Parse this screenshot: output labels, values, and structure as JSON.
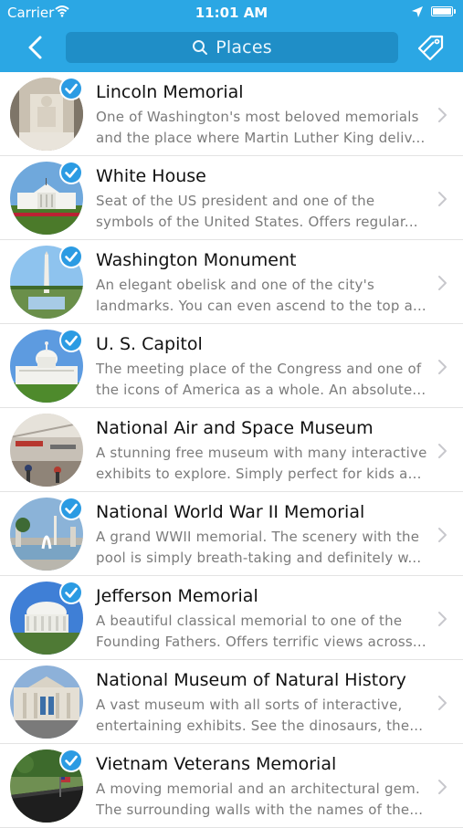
{
  "status_bar": {
    "carrier": "Carrier",
    "time": "11:01 AM"
  },
  "nav": {
    "search_placeholder": "Places"
  },
  "colors": {
    "accent": "#2ba7e4",
    "search_bg": "#1f8ec7",
    "check": "#2b9be3"
  },
  "places": [
    {
      "title": "Lincoln Memorial",
      "line1": "One of Washington's most beloved memorials",
      "line2": "and the place where Martin Luther King deliv...",
      "checked": true,
      "thumb": "lincoln"
    },
    {
      "title": "White House",
      "line1": "Seat of the US president and one of the",
      "line2": "symbols of the United States. Offers regular...",
      "checked": true,
      "thumb": "whitehouse"
    },
    {
      "title": "Washington Monument",
      "line1": "An elegant obelisk and one of the city's",
      "line2": "landmarks. You can even ascend to the top a...",
      "checked": true,
      "thumb": "monument"
    },
    {
      "title": "U. S. Capitol",
      "line1": "The meeting place of the Congress and one of",
      "line2": "the icons of America as a whole. An absolute...",
      "checked": true,
      "thumb": "capitol"
    },
    {
      "title": "National Air and Space Museum",
      "line1": "A stunning free museum with many interactive",
      "line2": "exhibits to explore. Simply perfect for kids an...",
      "checked": false,
      "thumb": "airspace"
    },
    {
      "title": "National World War II Memorial",
      "line1": "A grand WWII memorial. The scenery with the",
      "line2": "pool is simply breath-taking and definitely w...",
      "checked": true,
      "thumb": "ww2"
    },
    {
      "title": "Jefferson Memorial",
      "line1": "A beautiful classical memorial to one of the",
      "line2": "Founding Fathers. Offers terrific views across...",
      "checked": true,
      "thumb": "jefferson"
    },
    {
      "title": "National Museum of Natural History",
      "line1": "A vast museum with all sorts of interactive,",
      "line2": "entertaining exhibits. See the dinosaurs, the...",
      "checked": false,
      "thumb": "naturalhistory"
    },
    {
      "title": "Vietnam Veterans Memorial",
      "line1": "A moving memorial and an architectural gem.",
      "line2": "The surrounding walls with the names of the...",
      "checked": true,
      "thumb": "vietnam"
    }
  ]
}
